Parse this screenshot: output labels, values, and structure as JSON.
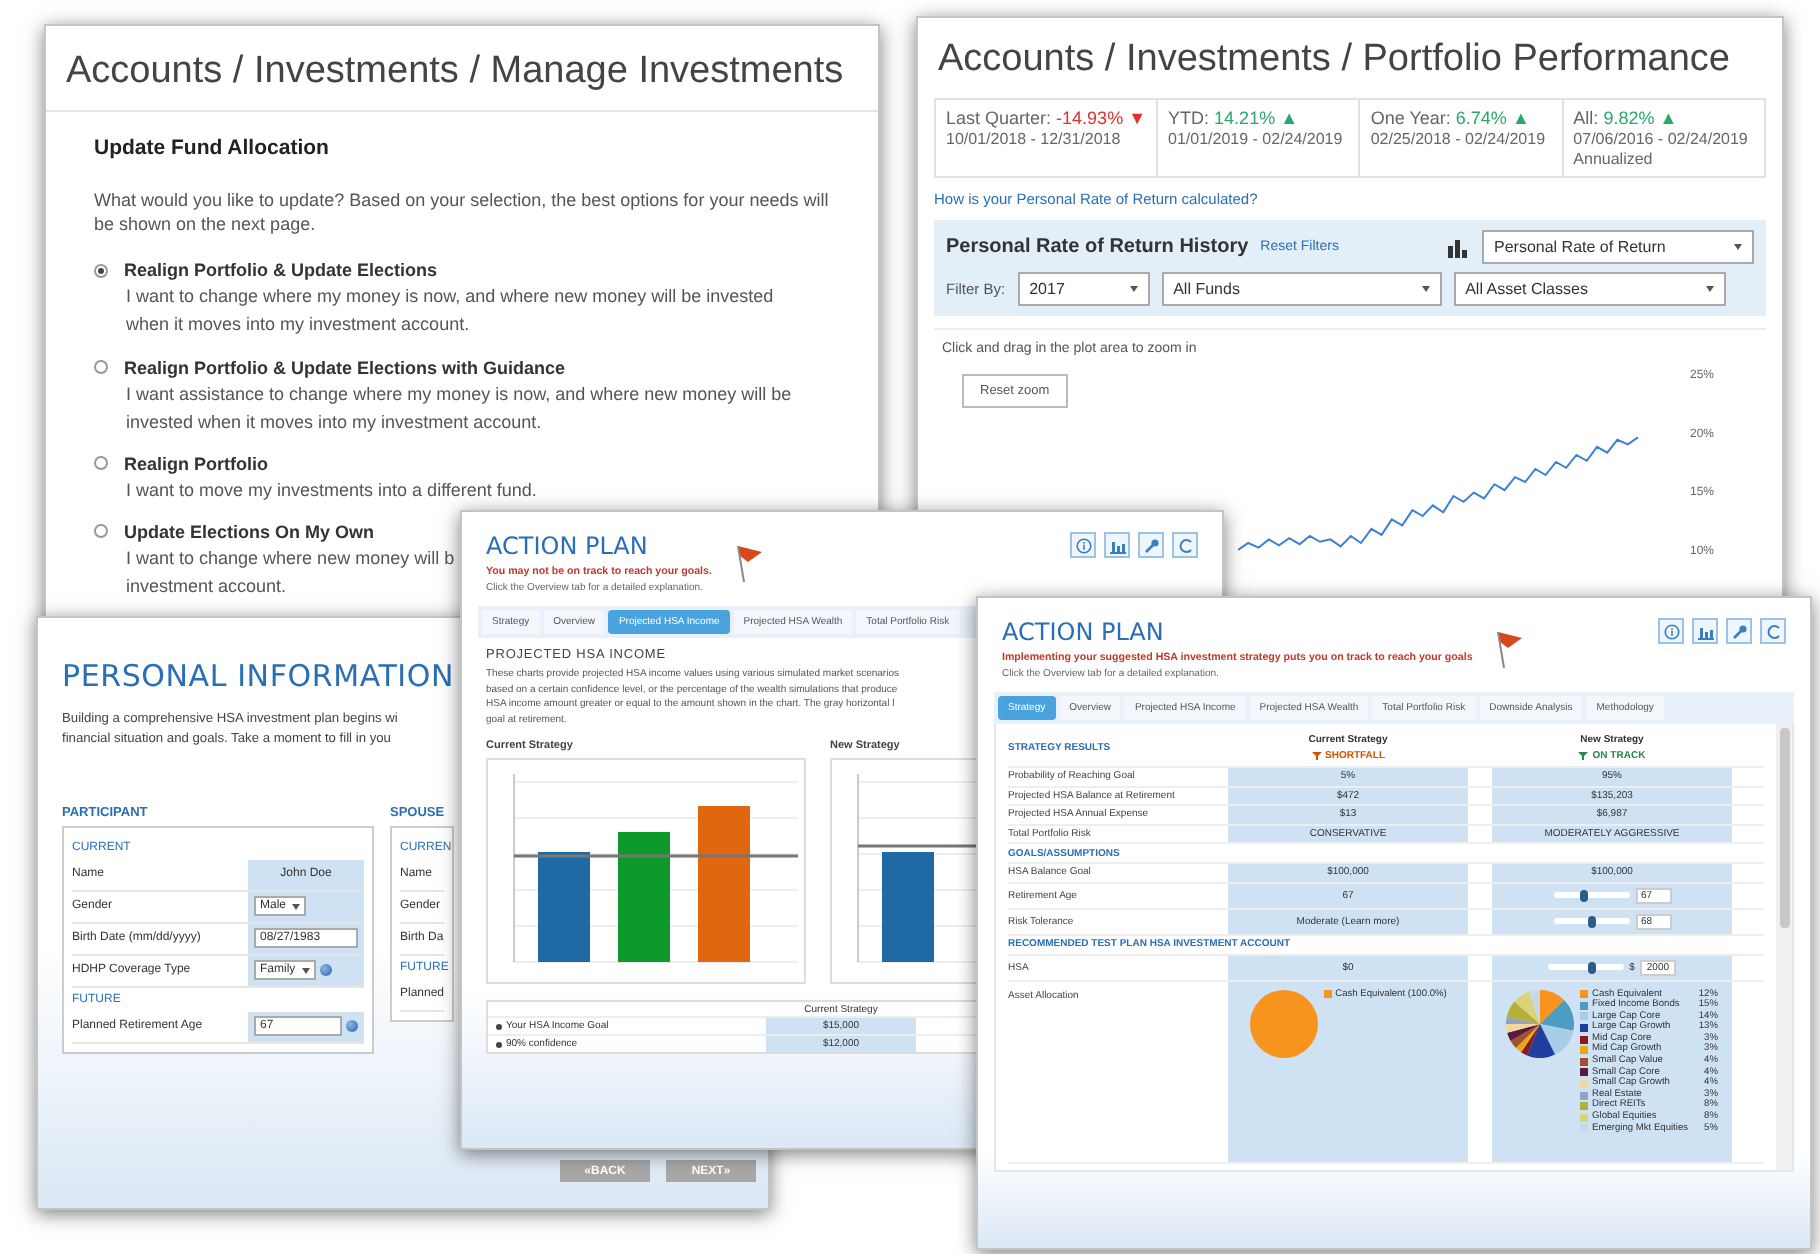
{
  "manage_investments": {
    "title": "Accounts / Investments / Manage Investments",
    "section_title": "Update Fund Allocation",
    "intro": "What would you like to update? Based on your selection, the best options for your needs will be shown on the next page.",
    "options": [
      {
        "label": "Realign Portfolio & Update Elections",
        "description_lines": [
          "I want to change where my money is now, and where new money will be invested",
          "when it moves into my investment account."
        ],
        "selected": true
      },
      {
        "label": "Realign Portfolio & Update Elections with Guidance",
        "description_lines": [
          "I want assistance to change where my money is now, and where new money will be",
          "invested when it moves into my investment account."
        ],
        "selected": false
      },
      {
        "label": "Realign Portfolio",
        "description_lines": [
          "I want to move my investments into a different fund."
        ],
        "selected": false
      },
      {
        "label": "Update Elections On My Own",
        "description_lines": [
          "I want to change where new money will b",
          "investment account."
        ],
        "selected": false
      }
    ]
  },
  "portfolio_performance": {
    "title": "Accounts / Investments / Portfolio Performance",
    "stats": [
      {
        "label": "Last Quarter:",
        "value": "-14.93%",
        "kind": "down",
        "arrow": "▼",
        "dates": "10/01/2018 - 12/31/2018"
      },
      {
        "label": "YTD:",
        "value": "14.21%",
        "kind": "up",
        "arrow": "▲",
        "dates": "01/01/2019 - 02/24/2019"
      },
      {
        "label": "One Year:",
        "value": "6.74%",
        "kind": "up",
        "arrow": "▲",
        "dates": "02/25/2018 - 02/24/2019"
      },
      {
        "label": "All:",
        "value": "9.82%",
        "kind": "up",
        "arrow": "▲",
        "dates": "07/06/2016 - 02/24/2019",
        "note": "Annualized"
      }
    ],
    "link": "How is your Personal Rate of Return calculated?",
    "history": {
      "title": "Personal Rate of Return History",
      "reset_link": "Reset Filters",
      "metric": "Personal Rate of Return",
      "filter_label": "Filter By:",
      "filters": [
        "2017",
        "All Funds",
        "All Asset Classes"
      ]
    },
    "chart": {
      "hint": "Click and drag in the plot area to zoom in",
      "reset_button": "Reset zoom",
      "chart_data": {
        "type": "line",
        "ylim": [
          10,
          25
        ],
        "yticks": [
          {
            "value": 25,
            "label": "25%"
          },
          {
            "value": 20,
            "label": "20%"
          },
          {
            "value": 15,
            "label": "15%"
          },
          {
            "value": 10,
            "label": "10%"
          }
        ],
        "series": [
          {
            "color": "#3b82d6",
            "values": [
              10.0,
              10.6,
              10.2,
              10.9,
              10.4,
              11.0,
              10.5,
              11.2,
              10.7,
              10.9,
              10.3,
              11.2,
              10.6,
              11.8,
              11.3,
              12.6,
              12.1,
              13.4,
              12.9,
              13.8,
              13.2,
              14.6,
              14.1,
              14.9,
              14.4,
              15.6,
              15.1,
              16.2,
              15.8,
              16.9,
              16.4,
              17.5,
              17.0,
              18.1,
              17.6,
              18.8,
              18.3,
              19.4,
              19.0,
              19.6
            ]
          }
        ]
      }
    }
  },
  "personal_information": {
    "title": "PERSONAL INFORMATION",
    "intro_lines": [
      "Building a comprehensive HSA investment plan begins wi",
      "financial situation and goals. Take a moment to fill in you"
    ],
    "participant": {
      "heading": "PARTICIPANT",
      "current": "CURRENT",
      "fields": [
        {
          "label": "Name",
          "value": "John Doe",
          "kind": "text",
          "help": false
        },
        {
          "label": "Gender",
          "value": "Male",
          "kind": "select",
          "help": false
        },
        {
          "label": "Birth Date (mm/dd/yyyy)",
          "value": "08/27/1983",
          "kind": "input",
          "help": false
        },
        {
          "label": "HDHP Coverage Type",
          "value": "Family",
          "kind": "select",
          "help": true
        }
      ],
      "future": "FUTURE",
      "future_fields": [
        {
          "label": "Planned Retirement Age",
          "value": "67",
          "kind": "input",
          "help": true
        }
      ]
    },
    "spouse": {
      "heading": "SPOUSE",
      "current": "CURREN",
      "labels": [
        "Name",
        "Gender",
        "Birth Da"
      ],
      "future": "FUTURE",
      "future_labels": [
        "Planned"
      ]
    },
    "buttons": [
      "«BACK",
      "NEXT»"
    ]
  },
  "action_plan_income": {
    "title": "ACTION PLAN",
    "status_message": "You may not be on track to reach your goals.",
    "hint": "Click the Overview tab for a detailed explanation.",
    "tabs": [
      {
        "label": "Strategy",
        "selected": false
      },
      {
        "label": "Overview",
        "selected": false
      },
      {
        "label": "Projected HSA Income",
        "selected": true
      },
      {
        "label": "Projected HSA Wealth",
        "selected": false
      },
      {
        "label": "Total Portfolio Risk",
        "selected": false
      }
    ],
    "section_title": "PROJECTED HSA INCOME",
    "paragraph_lines": [
      "These charts provide projected HSA income values using various simulated market scenarios",
      "based on a certain confidence level, or the percentage of the wealth simulations that produce",
      "HSA income amount greater or equal to the amount shown in the chart. The gray horizontal l",
      "goal at retirement."
    ],
    "charts": [
      "Current Strategy",
      "New Strategy"
    ],
    "legend_header": "Current Strategy",
    "legend": [
      {
        "label": "Your HSA Income Goal",
        "value": "$15,000"
      },
      {
        "label": "90% confidence",
        "value": "$12,000"
      }
    ]
  },
  "action_plan_strategy": {
    "title": "ACTION PLAN",
    "status_message": "Implementing your suggested HSA investment strategy puts you on track to reach your goals",
    "hint": "Click the Overview tab for a detailed explanation.",
    "tabs": [
      {
        "label": "Strategy",
        "selected": true
      },
      {
        "label": "Overview",
        "selected": false
      },
      {
        "label": "Projected HSA Income",
        "selected": false
      },
      {
        "label": "Projected HSA Wealth",
        "selected": false
      },
      {
        "label": "Total Portfolio Risk",
        "selected": false
      },
      {
        "label": "Downside Analysis",
        "selected": false
      },
      {
        "label": "Methodology",
        "selected": false
      }
    ],
    "results_heading": "STRATEGY RESULTS",
    "columns": [
      {
        "title": "Current Strategy",
        "status": "SHORTFALL",
        "kind": "shortfall"
      },
      {
        "title": "New Strategy",
        "status": "ON TRACK",
        "kind": "on_track"
      }
    ],
    "rows": [
      {
        "kind": "text",
        "label": "Probability of Reaching Goal",
        "current": "5%",
        "new": "95%"
      },
      {
        "kind": "text",
        "label": "Projected HSA Balance at Retirement",
        "current": "$472",
        "new": "$135,203"
      },
      {
        "kind": "text",
        "label": "Projected HSA Annual Expense",
        "current": "$13",
        "new": "$6,987"
      },
      {
        "kind": "text",
        "label": "Total Portfolio Risk",
        "current": "CONSERVATIVE",
        "new": "MODERATELY AGGRESSIVE"
      },
      {
        "kind": "section",
        "label": "GOALS/ASSUMPTIONS"
      },
      {
        "kind": "text",
        "label": "HSA Balance Goal",
        "current": "$100,000",
        "new": "$100,000"
      },
      {
        "kind": "slider",
        "label": "Retirement Age",
        "current": "67",
        "level": 0.4,
        "new": "67"
      },
      {
        "kind": "slider",
        "label": "Risk Tolerance",
        "current": "Moderate (Learn more)",
        "level": 0.5,
        "new": "68"
      },
      {
        "kind": "section",
        "label": "RECOMMENDED TEST PLAN HSA INVESTMENT ACCOUNT"
      },
      {
        "kind": "slider",
        "label": "HSA",
        "current": "$0",
        "level": 0.6,
        "prefix": "$",
        "new": "2000"
      },
      {
        "kind": "allocation",
        "label": "Asset Allocation",
        "current_allocation": {
          "chart_data": {
            "type": "pie",
            "categories": [
              "Cash Equivalent"
            ],
            "values": [
              100
            ],
            "value_labels": [
              "(100.0%)"
            ],
            "legend": true
          }
        },
        "new_allocation": {
          "chart_data": {
            "type": "pie",
            "categories": [
              "Cash Equivalent",
              "Fixed Income Bonds",
              "Large Cap Core",
              "Large Cap Growth",
              "Mid Cap Core",
              "Mid Cap Growth",
              "Small Cap Value",
              "Small Cap Core",
              "Small Cap Growth",
              "Real Estate",
              "Direct REITs",
              "Global Equities",
              "Emerging Mkt Equities"
            ],
            "values": [
              12,
              15,
              14,
              13,
              3,
              3,
              4,
              4,
              4,
              3,
              8,
              8,
              5
            ],
            "value_labels": [
              "12%",
              "15%",
              "14%",
              "13%",
              "3%",
              "3%",
              "4%",
              "4%",
              "4%",
              "3%",
              "8%",
              "8%",
              "5%"
            ],
            "legend": true
          }
        }
      }
    ]
  }
}
